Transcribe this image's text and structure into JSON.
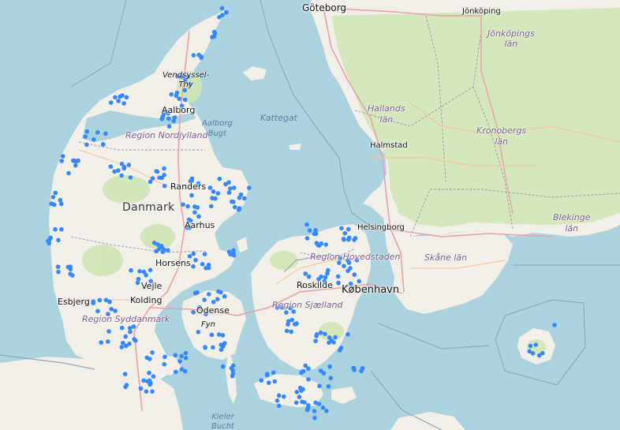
{
  "map": {
    "colors": {
      "water": "#aad3df",
      "land": "#f2efe9",
      "forest": "#cfe6b4",
      "road_major": "#e9a0a6",
      "road_primary": "#f7c79a",
      "border": "#9d8fa8",
      "marker": "#3388ff"
    },
    "labels": {
      "goteborg": "Göteborg",
      "jonkoping": "Jönköping",
      "jonkopings_lan": "Jönköpings\nlän",
      "vendsyssel_thy": "Vendsyssel-\nThy",
      "aalborg": "Aalborg",
      "hallands_lan": "Hallands\nlän",
      "region_nordjylland": "Region Nordjylland",
      "aalborg_bugt": "Aalborg\nBugt",
      "kattegat": "Kattegat",
      "kronobergs_lan": "Kronobergs\nlän",
      "halmstad": "Halmstad",
      "randers": "Randers",
      "danmark": "Danmark",
      "blekinge_lan": "Blekinge\nlän",
      "aarhus": "Aarhus",
      "helsingborg": "Helsingborg",
      "region_hovedstaden": "Region Hovedstaden",
      "horsens": "Horsens",
      "skane_lan": "Skåne län",
      "vejle": "Vejle",
      "roskilde": "Roskilde",
      "kobenhavn": "København",
      "esbjerg": "Esbjerg",
      "kolding": "Kolding",
      "region_sjaelland": "Region Sjælland",
      "odense": "Odense",
      "region_syddanmark": "Region Syddanmark",
      "fyn": "Fyn",
      "kieler_bucht": "Kieler\nBucht"
    }
  }
}
